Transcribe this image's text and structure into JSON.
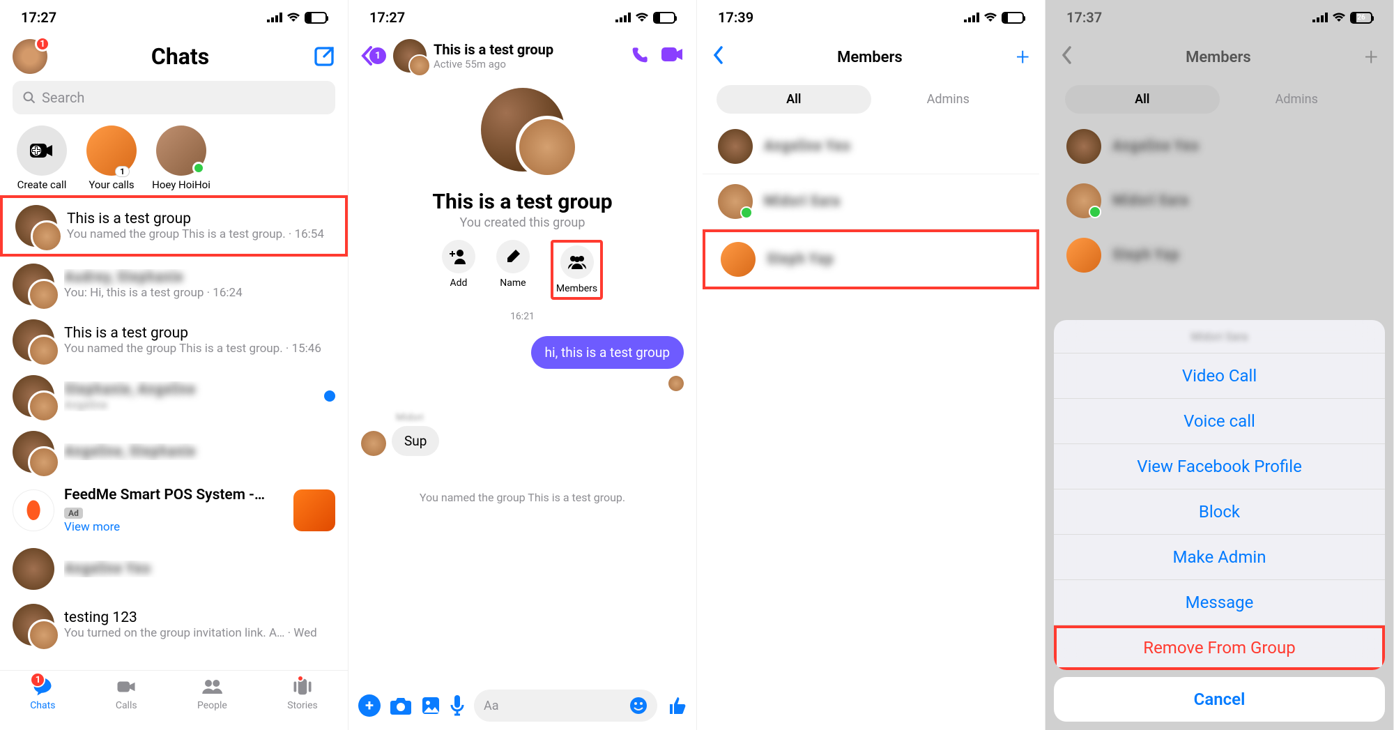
{
  "s1": {
    "time": "17:27",
    "battery": "27",
    "title": "Chats",
    "profileBadge": "1",
    "searchPlaceholder": "Search",
    "stories": [
      {
        "label": "Create call"
      },
      {
        "label": "Your calls",
        "count": "1"
      },
      {
        "label": "Hoey HoiHoi"
      }
    ],
    "chats": [
      {
        "title": "This is a test group",
        "sub": "You named the group This is a test group. · 16:54"
      },
      {
        "title": "Audrey, Stephanie",
        "sub": "You: Hi, this is a test group · 16:24"
      },
      {
        "title": "This is a test group",
        "sub": "You named the group This is a test group. · 15:46"
      },
      {
        "title": "Stephanie, Angeline",
        "sub": "Angeline"
      },
      {
        "title": "Angeline, Stephanie",
        "sub": ""
      },
      {
        "title": "FeedMe Smart POS System -…",
        "sub": "View more",
        "ad": "Ad"
      },
      {
        "title": "Angeline Yeo",
        "sub": ""
      },
      {
        "title": "testing 123",
        "sub": "You turned on the group invitation link. A… · Wed"
      }
    ],
    "tabs": {
      "chats": "Chats",
      "calls": "Calls",
      "people": "People",
      "stories": "Stories",
      "badge": "1"
    }
  },
  "s2": {
    "time": "17:27",
    "battery": "27",
    "backBadge": "1",
    "title": "This is a test group",
    "subtitle": "Active 55m ago",
    "groupName": "This is a test group",
    "created": "You created this group",
    "actions": {
      "add": "Add",
      "name": "Name",
      "members": "Members"
    },
    "timestamp": "16:21",
    "msgOut": "hi, this is a test group",
    "msgIn": "Sup",
    "systemMsg": "You named the group This is a test group.",
    "inputPlaceholder": "Aa"
  },
  "s3": {
    "time": "17:39",
    "battery": "26",
    "title": "Members",
    "tabAll": "All",
    "tabAdmins": "Admins",
    "members": [
      {
        "name": "Angeline Yeo"
      },
      {
        "name": "Midori Sara"
      },
      {
        "name": "Steph Yap"
      }
    ]
  },
  "s4": {
    "time": "17:37",
    "battery": "26",
    "title": "Members",
    "tabAll": "All",
    "tabAdmins": "Admins",
    "members": [
      {
        "name": "Angeline Yeo"
      },
      {
        "name": "Midori Sara"
      },
      {
        "name": "Steph Yap"
      }
    ],
    "sheetTitle": "Midori Sara",
    "actions": {
      "videoCall": "Video Call",
      "voiceCall": "Voice call",
      "viewProfile": "View Facebook Profile",
      "block": "Block",
      "makeAdmin": "Make Admin",
      "message": "Message",
      "remove": "Remove From Group",
      "cancel": "Cancel"
    }
  }
}
